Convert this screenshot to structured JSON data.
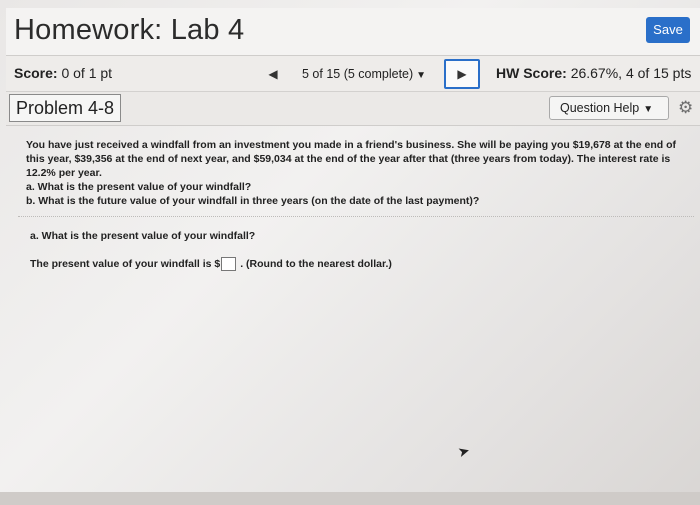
{
  "header": {
    "title": "Homework: Lab 4",
    "save_label": "Save"
  },
  "score_bar": {
    "score_label": "Score:",
    "score_value": "0 of 1 pt",
    "nav_status": "5 of 15 (5 complete)",
    "hw_score_label": "HW Score:",
    "hw_score_value": "26.67%, 4 of 15 pts"
  },
  "problem_bar": {
    "title": "Problem 4-8",
    "question_help_label": "Question Help"
  },
  "question": {
    "body": "You have just received a windfall from an investment you made in a friend's business. She will be paying you $19,678 at the end of this year, $39,356 at the end of next year, and $59,034 at the end of the year after that (three years from today). The interest rate is 12.2% per year.",
    "part_a": "a. What is the present value of your windfall?",
    "part_b": "b. What is the future value of your windfall in three years (on the date of the last payment)?"
  },
  "answer_section": {
    "prompt": "a. What is the present value of your windfall?",
    "answer_prefix": "The present value of your windfall is $",
    "answer_value": "",
    "answer_suffix": ". (Round to the nearest dollar.)"
  }
}
